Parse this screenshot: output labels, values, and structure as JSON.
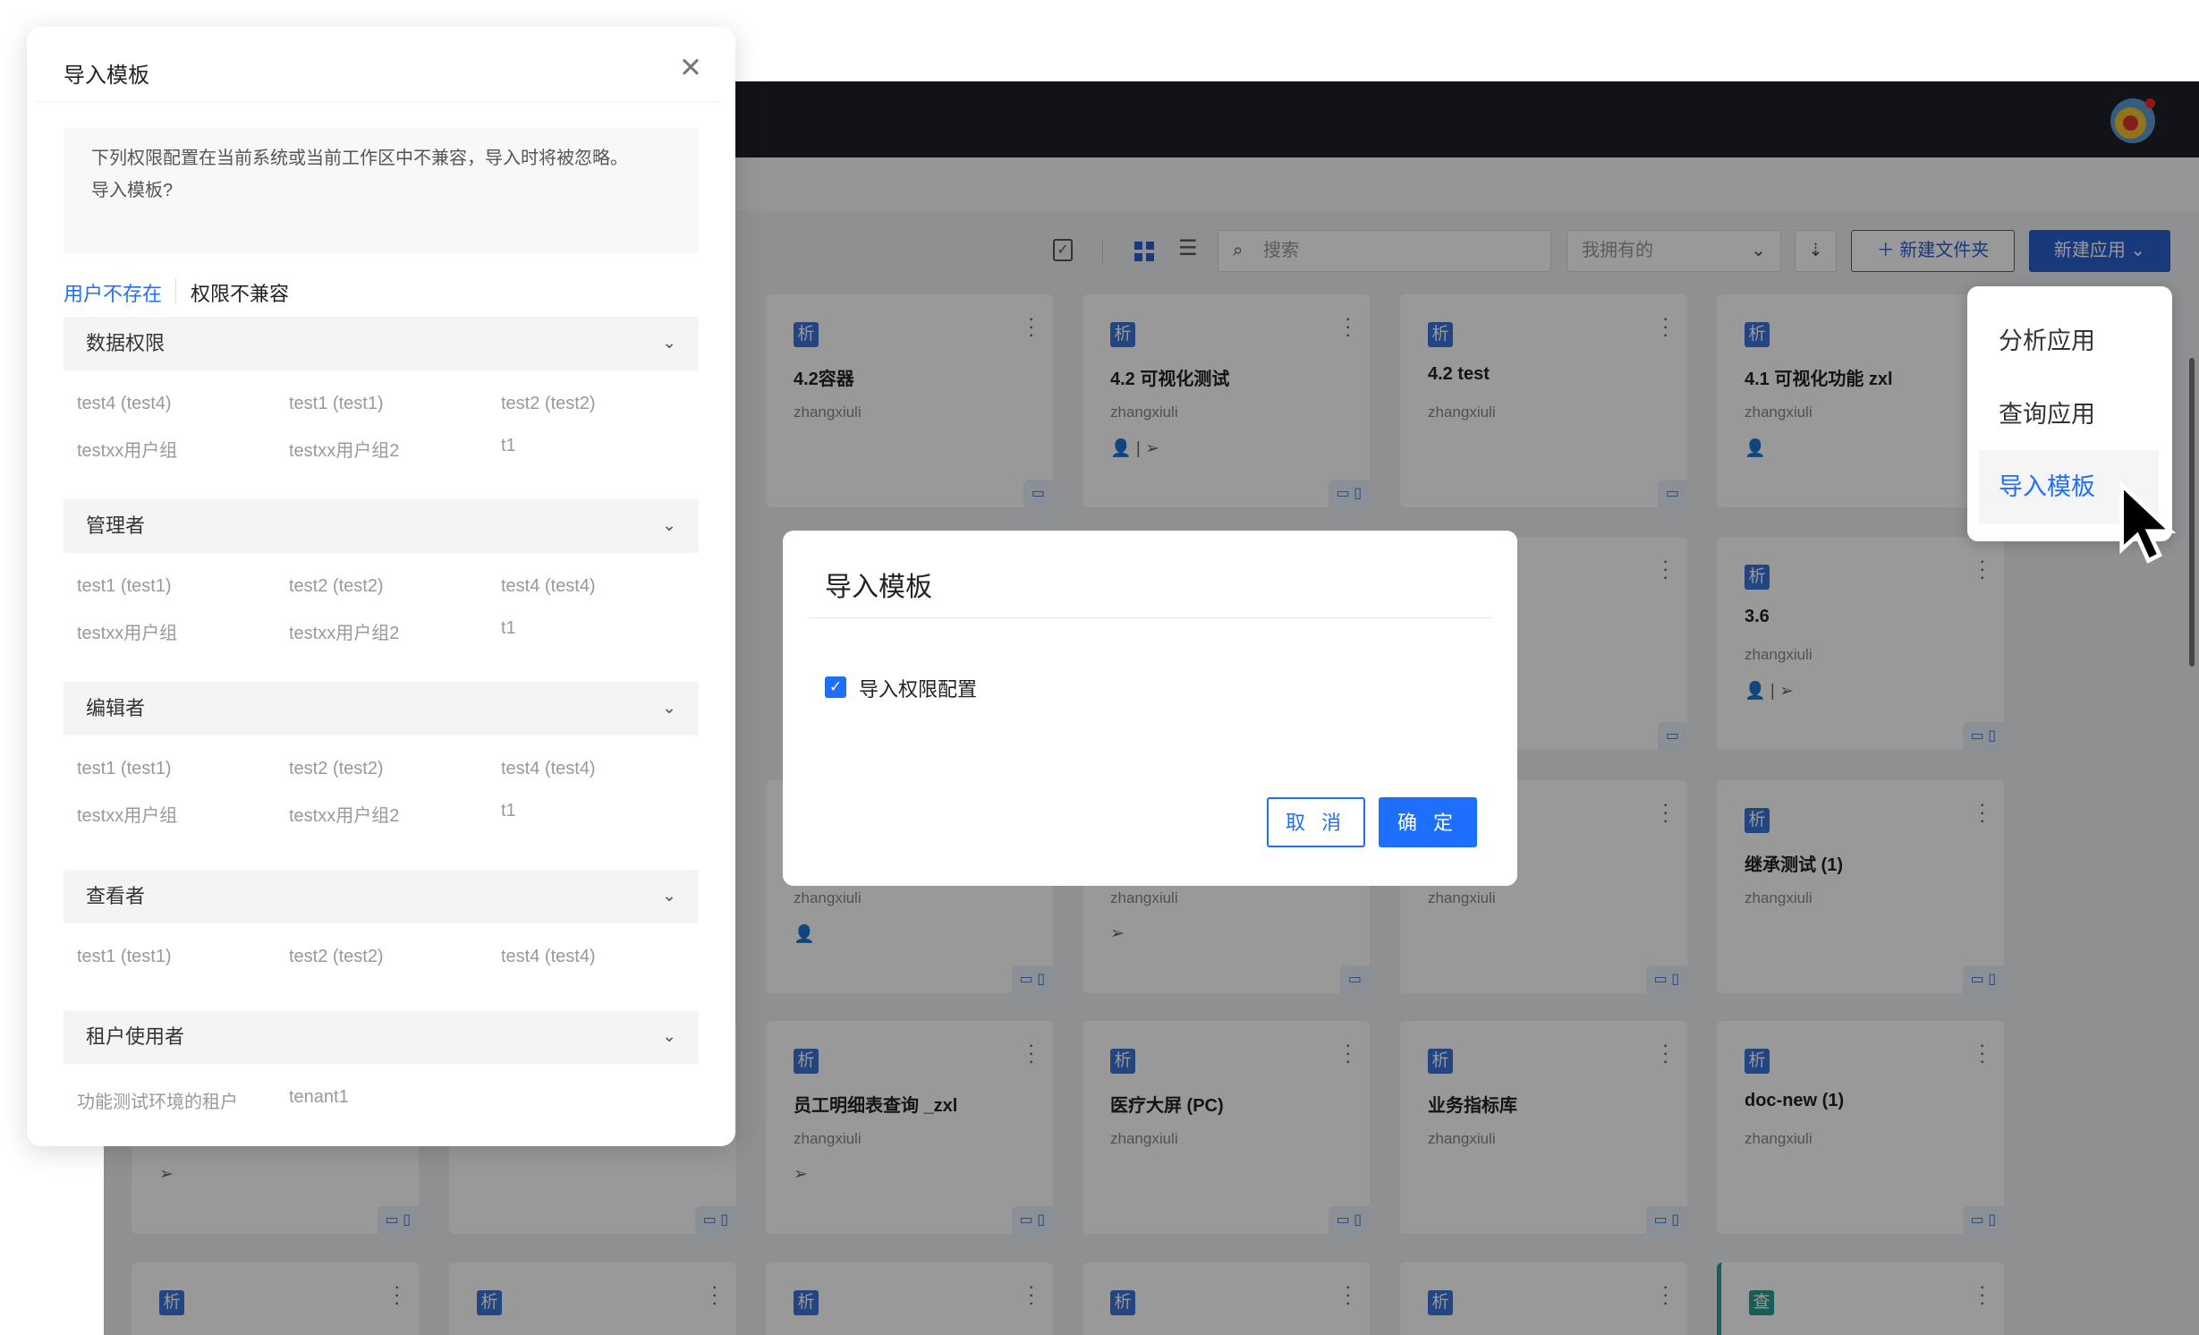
{
  "header": {
    "avatar": "avatar"
  },
  "toolbar": {
    "search_placeholder": "搜索",
    "filter_value": "我拥有的",
    "new_folder": "新建文件夹",
    "new_app": "新建应用"
  },
  "new_app_menu": [
    {
      "label": "分析应用"
    },
    {
      "label": "查询应用"
    },
    {
      "label": "导入模板",
      "active": true
    }
  ],
  "cards": [
    {
      "tag": "析",
      "title": "4.2容器",
      "owner": "zhangxiuli",
      "icons": "",
      "devices": "▭"
    },
    {
      "tag": "析",
      "title": "4.2 可视化测试",
      "owner": "zhangxiuli",
      "icons": "👤 | ➢",
      "devices": "▭ ▯"
    },
    {
      "tag": "析",
      "title": "4.2 test",
      "owner": "zhangxiuli",
      "icons": "",
      "devices": "▭"
    },
    {
      "tag": "析",
      "title": "4.1 可视化功能 zxl",
      "owner": "zhangxiuli",
      "icons": "👤",
      "devices": "▭"
    },
    {
      "tag": "",
      "title": "",
      "owner": "",
      "icons": "",
      "devices": "▭"
    },
    {
      "tag": "析",
      "title": "3.6",
      "owner": "zhangxiuli",
      "icons": "👤 | ➢",
      "devices": "▭ ▯"
    },
    {
      "tag": "",
      "title": "",
      "owner": "zhangxiuli",
      "icons": "👤",
      "devices": "▭ ▯"
    },
    {
      "tag": "",
      "title": "",
      "owner": "zhangxiuli",
      "icons": "➢",
      "devices": "▭"
    },
    {
      "tag": "",
      "title": "",
      "owner": "zhangxiuli",
      "icons": "",
      "devices": "▭ ▯"
    },
    {
      "tag": "析",
      "title": "继承测试 (1)",
      "owner": "zhangxiuli",
      "icons": "",
      "devices": "▭ ▯"
    },
    {
      "tag": "",
      "title": "",
      "owner": "",
      "icons": "➢",
      "devices": "▭ ▯"
    },
    {
      "tag": "",
      "title": "",
      "owner": "",
      "icons": "",
      "devices": "▭ ▯"
    },
    {
      "tag": "析",
      "title": "员工明细表查询 _zxl",
      "owner": "zhangxiuli",
      "icons": "➢",
      "devices": "▭ ▯"
    },
    {
      "tag": "析",
      "title": "医疗大屏 (PC)",
      "owner": "zhangxiuli",
      "icons": "",
      "devices": "▭ ▯"
    },
    {
      "tag": "析",
      "title": "业务指标库",
      "owner": "zhangxiuli",
      "icons": "",
      "devices": "▭ ▯"
    },
    {
      "tag": "析",
      "title": "doc-new (1)",
      "owner": "zhangxiuli",
      "icons": "",
      "devices": "▭ ▯"
    },
    {
      "tag": "析",
      "title": "",
      "owner": "",
      "icons": "",
      "devices": ""
    },
    {
      "tag": "析",
      "title": "",
      "owner": "",
      "icons": "",
      "devices": ""
    },
    {
      "tag": "析",
      "title": "",
      "owner": "",
      "icons": "",
      "devices": ""
    },
    {
      "tag": "析",
      "title": "",
      "owner": "",
      "icons": "",
      "devices": ""
    },
    {
      "tag": "析",
      "title": "",
      "owner": "",
      "icons": "",
      "devices": ""
    },
    {
      "tag": "查",
      "title": "",
      "owner": "",
      "icons": "",
      "devices": ""
    }
  ],
  "drawer": {
    "title": "导入模板",
    "notice_line1": "下列权限配置在当前系统或当前工作区中不兼容，导入时将被忽略。",
    "notice_line2": "导入模板?",
    "tabs": [
      {
        "label": "用户不存在",
        "active": true
      },
      {
        "label": "权限不兼容"
      }
    ],
    "sections": [
      {
        "title": "数据权限",
        "items": [
          "test4 (test4)",
          "test1 (test1)",
          "test2 (test2)",
          "testxx用户组",
          "testxx用户组2",
          "t1"
        ]
      },
      {
        "title": "管理者",
        "items": [
          "test1 (test1)",
          "test2 (test2)",
          "test4 (test4)",
          "testxx用户组",
          "testxx用户组2",
          "t1"
        ]
      },
      {
        "title": "编辑者",
        "items": [
          "test1 (test1)",
          "test2 (test2)",
          "test4 (test4)",
          "testxx用户组",
          "testxx用户组2",
          "t1"
        ]
      },
      {
        "title": "查看者",
        "items": [
          "test1 (test1)",
          "test2 (test2)",
          "test4 (test4)"
        ]
      },
      {
        "title": "租户使用者",
        "items": [
          "功能测试环境的租户",
          "tenant1"
        ]
      }
    ]
  },
  "modal": {
    "title": "导入模板",
    "checkbox_label": "导入权限配置",
    "checked": true,
    "cancel": "取 消",
    "ok": "确 定"
  },
  "colors": {
    "primary": "#1f6fff",
    "nav": "#1f2029",
    "tag_analysis": "#3b73d9",
    "tag_query": "#2a9d8f"
  }
}
